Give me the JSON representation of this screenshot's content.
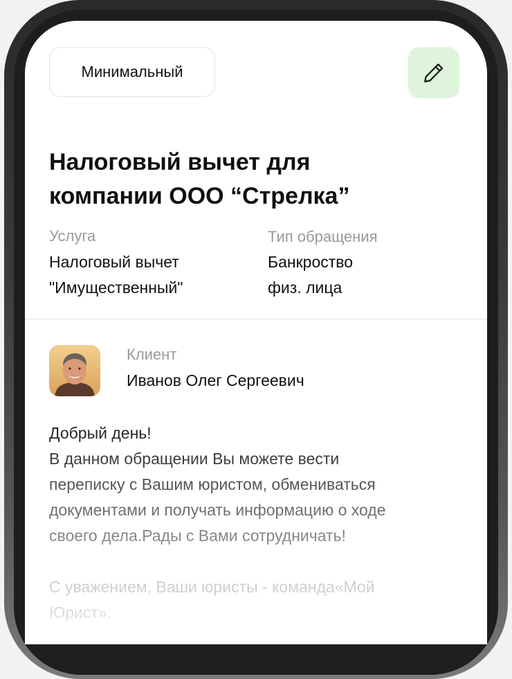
{
  "header": {
    "plan_label": "Минимальный",
    "edit_icon": "pencil-icon"
  },
  "request": {
    "title_line1": "Налоговый вычет для",
    "title_line2": "компании ООО “Стрелка”",
    "service_label": "Услуга",
    "service_value_line1": "Налоговый вычет",
    "service_value_line2": "\"Имущественный\"",
    "type_label": "Тип обращения",
    "type_value_line1": "Банкроство",
    "type_value_line2": "физ. лица"
  },
  "client": {
    "label": "Клиент",
    "name": "Иванов Олег Сергеевич"
  },
  "message": {
    "line1": "Добрый день!",
    "line2": "В данном обращении Вы можете вести",
    "line3": "переписку с Вашим юристом, обмениваться",
    "line4": "документами и получать информацию о ходе",
    "line5": "своего дела.Рады с Вами сотрудничать!",
    "signature_line1": "С уважением, Ваши юристы - команда«Мой",
    "signature_line2": "Юрист»."
  },
  "colors": {
    "edit_button_bg": "#def5dc",
    "device_frame": "#2a2a2a"
  }
}
